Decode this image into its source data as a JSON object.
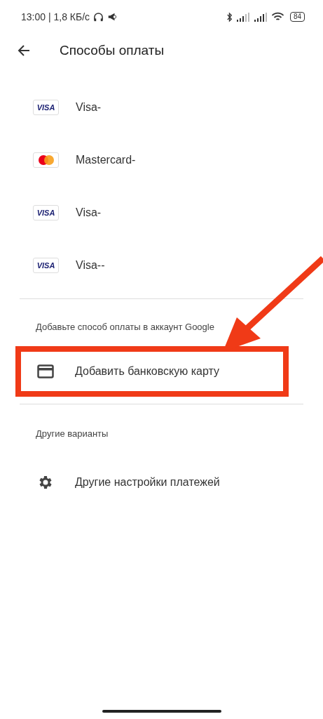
{
  "status_bar": {
    "time": "13:00 | 1,8 КБ/с",
    "battery": "84"
  },
  "header": {
    "title": "Способы оплаты"
  },
  "cards": [
    {
      "kind": "visa",
      "logo_text": "VISA",
      "label": "Visa-"
    },
    {
      "kind": "mastercard",
      "label": "Mastercard-"
    },
    {
      "kind": "visa",
      "logo_text": "VISA",
      "label": "Visa-"
    },
    {
      "kind": "visa",
      "logo_text": "VISA",
      "label": "Visa--"
    }
  ],
  "add_section": {
    "heading": "Добавьте способ оплаты в аккаунт Google",
    "items": [
      {
        "kind": "card",
        "label": "Добавить банковскую карту"
      }
    ]
  },
  "other_section": {
    "heading": "Другие варианты",
    "items": [
      {
        "kind": "settings",
        "label": "Другие настройки платежей"
      }
    ]
  },
  "annotation": {
    "highlight": true,
    "arrow": true
  }
}
